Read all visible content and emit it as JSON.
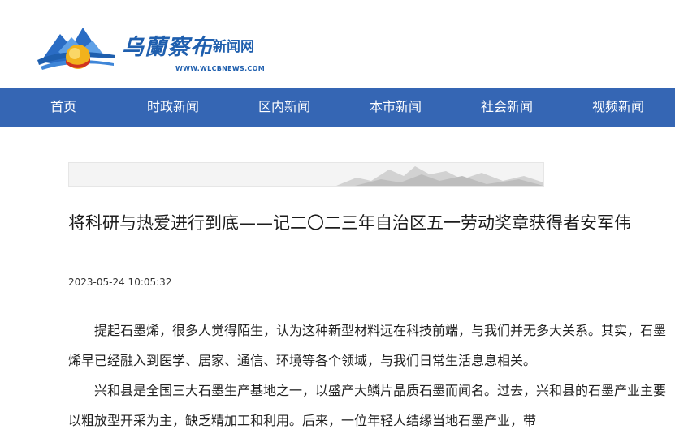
{
  "site": {
    "logo_cn": "乌蘭察布",
    "logo_sub": "新闻网",
    "logo_url": "WWW.WLCBNEWS.COM"
  },
  "nav": {
    "items": [
      "首页",
      "时政新闻",
      "区内新闻",
      "本市新闻",
      "社会新闻",
      "视频新闻"
    ]
  },
  "article": {
    "title": "将科研与热爱进行到底——记二〇二三年自治区五一劳动奖章获得者安军伟",
    "date": "2023-05-24 10:05:32",
    "paragraphs": [
      "提起石墨烯，很多人觉得陌生，认为这种新型材料远在科技前端，与我们并无多大关系。其实，石墨烯早已经融入到医学、居家、通信、环境等各个领域，与我们日常生活息息相关。",
      "兴和县是全国三大石墨生产基地之一，以盛产大鳞片晶质石墨而闻名。过去，兴和县的石墨产业主要以粗放型开采为主，缺乏精加工和利用。后来，一位年轻人结缘当地石墨产业，带"
    ]
  },
  "colors": {
    "nav_bg": "#3566b4",
    "brand_blue": "#1f5fae"
  }
}
